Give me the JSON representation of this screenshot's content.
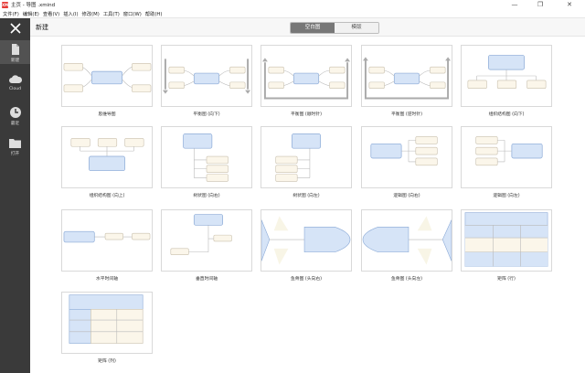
{
  "window": {
    "title": "主页 - 导图 .xmind",
    "app_logo": "XM",
    "controls": {
      "minimize": "—",
      "maximize": "❐",
      "close": "✕"
    }
  },
  "menu": [
    "文件(F)",
    "编辑(E)",
    "查看(V)",
    "插入(I)",
    "修改(M)",
    "工具(T)",
    "窗口(W)",
    "帮助(H)"
  ],
  "sidebar": {
    "close_icon": "close-icon",
    "items": [
      {
        "label": "新建",
        "icon": "new-document-icon",
        "active": true
      },
      {
        "label": "Cloud",
        "icon": "cloud-icon",
        "active": false
      },
      {
        "label": "最近",
        "icon": "clock-icon",
        "active": false
      },
      {
        "label": "打开",
        "icon": "folder-icon",
        "active": false
      }
    ]
  },
  "header": {
    "title": "新建",
    "tabs": [
      {
        "label": "空白图",
        "active": true
      },
      {
        "label": "模版",
        "active": false
      }
    ]
  },
  "templates": [
    {
      "label": "思维导图",
      "type": "mindmap"
    },
    {
      "label": "平衡图 (向下)",
      "type": "balance-down"
    },
    {
      "label": "平衡图 (顺时针)",
      "type": "balance-cw"
    },
    {
      "label": "平衡图 (逆时针)",
      "type": "balance-ccw"
    },
    {
      "label": "组织结构图 (向下)",
      "type": "org-down"
    },
    {
      "label": "组织结构图 (向上)",
      "type": "org-up"
    },
    {
      "label": "树状图 (向右)",
      "type": "tree-right"
    },
    {
      "label": "树状图 (向左)",
      "type": "tree-left"
    },
    {
      "label": "逻辑图 (向右)",
      "type": "logic-right"
    },
    {
      "label": "逻辑图 (向左)",
      "type": "logic-left"
    },
    {
      "label": "水平时间轴",
      "type": "timeline-h"
    },
    {
      "label": "垂直时间轴",
      "type": "timeline-v"
    },
    {
      "label": "鱼骨图 (头向右)",
      "type": "fish-right"
    },
    {
      "label": "鱼骨图 (头向左)",
      "type": "fish-left"
    },
    {
      "label": "矩阵 (行)",
      "type": "matrix-row"
    },
    {
      "label": "矩阵 (列)",
      "type": "matrix-col"
    }
  ],
  "colors": {
    "sidebar_bg": "#3a3a3a",
    "central_topic_fill": "#d6e4f7",
    "central_topic_stroke": "#8aa9d6",
    "subtopic_fill": "#fbf6ea",
    "subtopic_stroke": "#c9c0ae",
    "active_tab": "#777777"
  }
}
